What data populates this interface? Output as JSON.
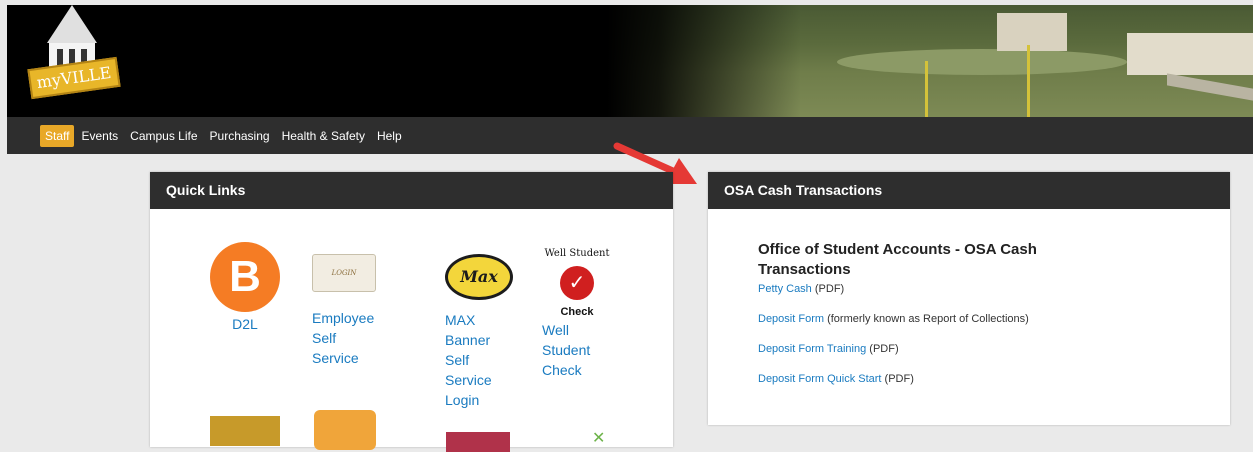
{
  "header": {
    "logo_text": "myVILLE"
  },
  "nav": {
    "items": [
      "Staff",
      "Events",
      "Campus Life",
      "Purchasing",
      "Health & Safety",
      "Help"
    ],
    "active": "Staff"
  },
  "quick_links": {
    "title": "Quick Links",
    "items": [
      {
        "label": "D2L",
        "icon": "d2l-icon"
      },
      {
        "label_lines": [
          "Employee",
          "Self",
          "Service"
        ],
        "icon": "employee-self-service-icon",
        "icon_text": "LOGIN"
      },
      {
        "label_lines": [
          "MAX",
          "Banner",
          "Self",
          "Service",
          "Login"
        ],
        "icon": "max-icon",
        "icon_text": "Max"
      },
      {
        "label_lines": [
          "Well",
          "Student",
          "Check"
        ],
        "icon": "well-student-check-icon",
        "icon_top": "Well Student",
        "icon_bottom": "Check"
      }
    ]
  },
  "osa": {
    "title": "OSA Cash Transactions",
    "heading": "Office of Student Accounts - OSA Cash Transactions",
    "links": [
      {
        "link": "Petty Cash",
        "suffix": " (PDF)"
      },
      {
        "link": "Deposit Form",
        "suffix": " (formerly known as Report of Collections)"
      },
      {
        "link": "Deposit Form Training",
        "suffix": " (PDF)"
      },
      {
        "link": "Deposit Form Quick Start",
        "suffix": " (PDF)"
      }
    ]
  },
  "colors": {
    "accent": "#e8a828",
    "link": "#1a7bc0",
    "panel_header": "#2e2e2e",
    "arrow": "#e53935"
  }
}
